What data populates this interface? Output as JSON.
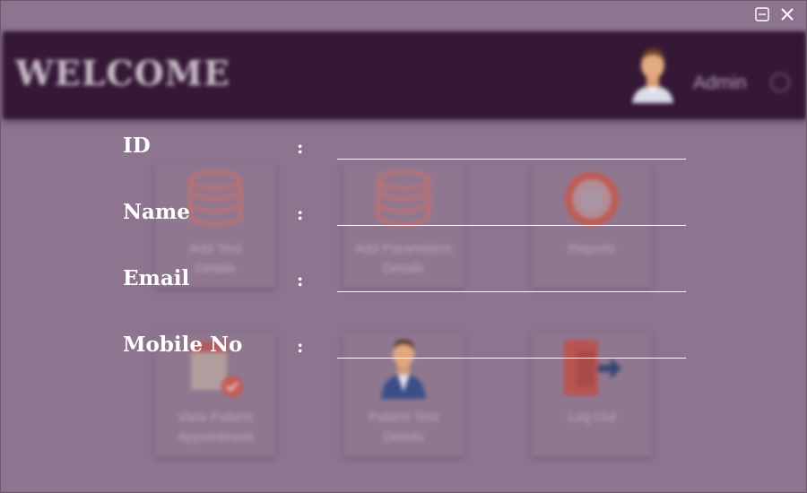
{
  "window": {
    "minimize_icon": "minimize-icon",
    "close_icon": "close-icon"
  },
  "header": {
    "title": "WELCOME",
    "user_label": "Admin"
  },
  "cards": [
    {
      "line1": "Add Test",
      "line2": "Details",
      "icon": "database-icon"
    },
    {
      "line1": "Add Parameters",
      "line2": "Details",
      "icon": "database-icon"
    },
    {
      "line1": "Reports",
      "line2": "",
      "icon": "report-icon"
    },
    {
      "line1": "View Patient",
      "line2": "Appointment",
      "icon": "appointment-icon"
    },
    {
      "line1": "Patient Test",
      "line2": "Details",
      "icon": "doctor-icon"
    },
    {
      "line1": "Log Out",
      "line2": "",
      "icon": "logout-icon"
    }
  ],
  "form": {
    "fields": [
      {
        "label": "ID",
        "colon": ":",
        "value": ""
      },
      {
        "label": "Name",
        "colon": ":",
        "value": ""
      },
      {
        "label": "Email",
        "colon": ":",
        "value": ""
      },
      {
        "label": "Mobile No",
        "colon": ":",
        "value": ""
      }
    ]
  }
}
